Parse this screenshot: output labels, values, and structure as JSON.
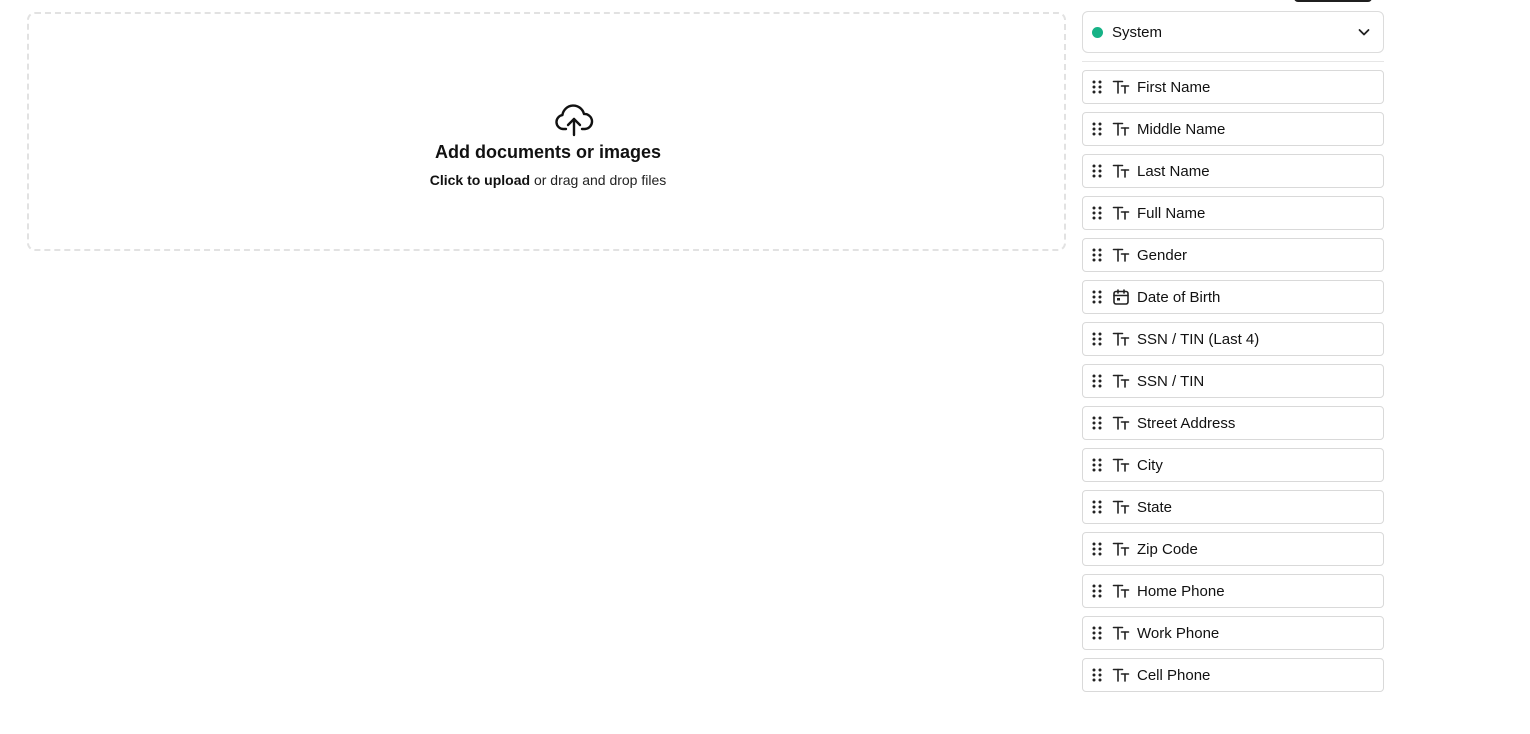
{
  "dropzone": {
    "title": "Add documents or images",
    "sub_bold": "Click to upload",
    "sub_rest": " or drag and drop files",
    "icon": "cloud-upload-icon"
  },
  "source_select": {
    "label": "System",
    "status_color": "#16b286",
    "icon": "chevron-down-icon"
  },
  "fields": [
    {
      "label": "First Name",
      "type": "text",
      "icon": "text-type-icon"
    },
    {
      "label": "Middle Name",
      "type": "text",
      "icon": "text-type-icon"
    },
    {
      "label": "Last Name",
      "type": "text",
      "icon": "text-type-icon"
    },
    {
      "label": "Full Name",
      "type": "text",
      "icon": "text-type-icon"
    },
    {
      "label": "Gender",
      "type": "text",
      "icon": "text-type-icon"
    },
    {
      "label": "Date of Birth",
      "type": "date",
      "icon": "calendar-icon"
    },
    {
      "label": "SSN / TIN (Last 4)",
      "type": "text",
      "icon": "text-type-icon"
    },
    {
      "label": "SSN / TIN",
      "type": "text",
      "icon": "text-type-icon"
    },
    {
      "label": "Street Address",
      "type": "text",
      "icon": "text-type-icon"
    },
    {
      "label": "City",
      "type": "text",
      "icon": "text-type-icon"
    },
    {
      "label": "State",
      "type": "text",
      "icon": "text-type-icon"
    },
    {
      "label": "Zip Code",
      "type": "text",
      "icon": "text-type-icon"
    },
    {
      "label": "Home Phone",
      "type": "text",
      "icon": "text-type-icon"
    },
    {
      "label": "Work Phone",
      "type": "text",
      "icon": "text-type-icon"
    },
    {
      "label": "Cell Phone",
      "type": "text",
      "icon": "text-type-icon"
    }
  ]
}
